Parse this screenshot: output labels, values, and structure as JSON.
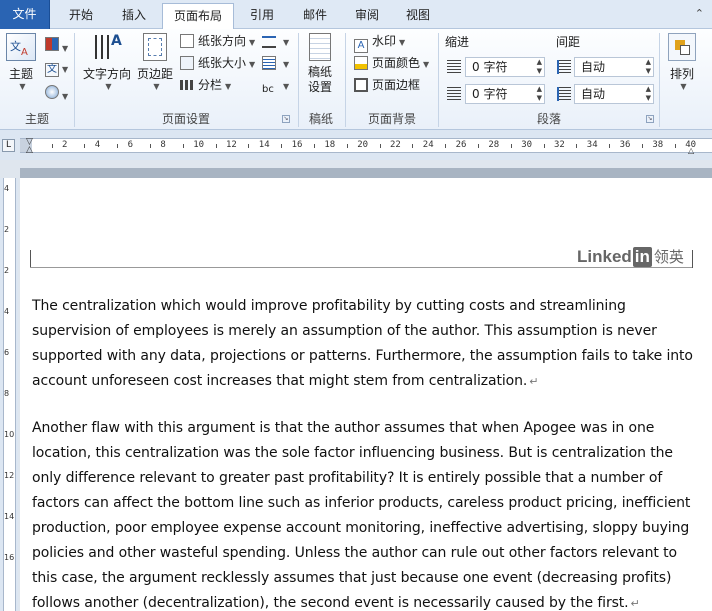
{
  "tabs": {
    "file": "文件",
    "home": "开始",
    "insert": "插入",
    "page_layout": "页面布局",
    "references": "引用",
    "mailings": "邮件",
    "review": "审阅",
    "view": "视图"
  },
  "ribbon": {
    "themes": {
      "theme_button": "主题",
      "group_label": "主题"
    },
    "page_setup": {
      "text_direction": "文字方向",
      "margins": "页边距",
      "orientation": "纸张方向",
      "size": "纸张大小",
      "columns": "分栏",
      "group_label": "页面设置"
    },
    "draft": {
      "draft_settings_line1": "稿纸",
      "draft_settings_line2": "设置",
      "group_label": "稿纸"
    },
    "page_background": {
      "watermark": "水印",
      "page_color": "页面颜色",
      "page_borders": "页面边框",
      "group_label": "页面背景"
    },
    "paragraph": {
      "indent_label": "缩进",
      "spacing_label": "间距",
      "indent_left_value": "0 字符",
      "indent_right_value": "0 字符",
      "spacing_before_value": "自动",
      "spacing_after_value": "自动",
      "group_label": "段落"
    },
    "arrange": {
      "arrange_button": "排列"
    }
  },
  "ruler": {
    "marks": [
      "2",
      "4",
      "6",
      "8",
      "10",
      "12",
      "14",
      "16",
      "18",
      "20",
      "22",
      "24",
      "26",
      "28",
      "30",
      "32",
      "34",
      "36",
      "38",
      "40"
    ]
  },
  "vruler": {
    "marks": [
      "4",
      "2",
      "2",
      "4",
      "6",
      "8",
      "10",
      "12",
      "14",
      "16"
    ]
  },
  "watermark": {
    "brand": "Linked",
    "in": "in",
    "cn": "领英"
  },
  "document": {
    "paragraphs": [
      "The centralization which would improve profitability by cutting costs and streamlining supervision of employees is merely an assumption of the author. This assumption is never supported with any data, projections or patterns. Furthermore,  the assumption fails to take into account unforeseen cost increases that might stem from centralization.",
      "Another flaw with this argument is that the author assumes that when Apogee was in one location, this centralization was the sole factor influencing business. But is centralization the only difference relevant to greater past profitability? It is entirely possible that a number of factors can affect the bottom line such as inferior products, careless product pricing, inefficient production, poor employee expense account monitoring, ineffective advertising, sloppy buying policies and other wasteful spending. Unless the author can rule out other factors relevant to this case, the argument recklessly assumes that just because one event (decreasing profits) follows another (decentralization), the second event is necessarily caused by the first."
    ],
    "paragraph_mark": "↵"
  }
}
